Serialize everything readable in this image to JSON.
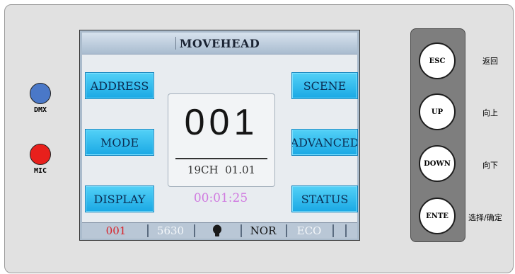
{
  "indicators": [
    {
      "label": "DMX",
      "color": "#4a78c8"
    },
    {
      "label": "MIC",
      "color": "#e8201c"
    }
  ],
  "screen": {
    "title": "MOVEHEAD",
    "left_buttons": [
      "ADDRESS",
      "MODE",
      "DISPLAY"
    ],
    "right_buttons": [
      "SCENE",
      "ADVANCED",
      "STATUS"
    ],
    "address_value": "001",
    "channel_mode": "19CH",
    "version": "01.01",
    "timer": "00:01:25",
    "status_bar": {
      "address": "001",
      "code": "5630",
      "icon": "bulb-icon",
      "mode": "NOR",
      "eco": "ECO"
    }
  },
  "hardware_buttons": [
    {
      "label": "ESC",
      "caption": "返回"
    },
    {
      "label": "UP",
      "caption": "向上"
    },
    {
      "label": "DOWN",
      "caption": "向下"
    },
    {
      "label": "ENTE",
      "caption": "选择/确定"
    }
  ],
  "colors": {
    "button_blue": "#1aa8e4",
    "timer_pink": "#d07ae0",
    "address_red": "#d8232a",
    "dmx_led": "#4a78c8",
    "mic_led": "#e8201c"
  }
}
